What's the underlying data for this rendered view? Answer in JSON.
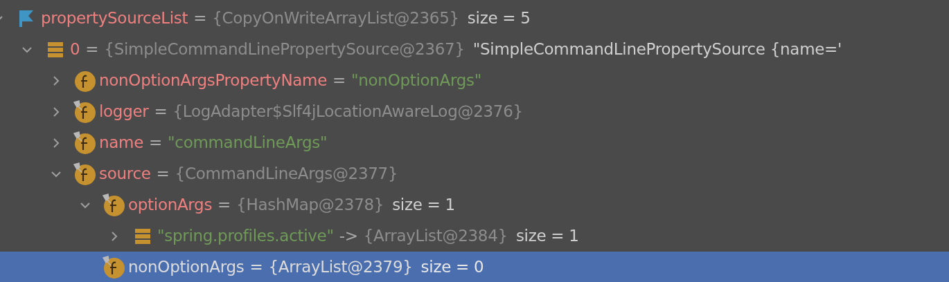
{
  "tree": [
    {
      "kind": "flag",
      "name": {
        "text": "propertySourceList",
        "kind": "field"
      },
      "separator": "=",
      "value": {
        "text": "{CopyOnWriteArrayList@2365}",
        "kind": "ref"
      },
      "extra": "size = 5",
      "expanded": true,
      "leaf": false,
      "selected": false,
      "children": [
        {
          "kind": "array",
          "name": {
            "text": "0",
            "kind": "field"
          },
          "separator": "=",
          "value": {
            "text": "{SimpleCommandLinePropertySource@2367}",
            "kind": "ref"
          },
          "extra": "\"SimpleCommandLinePropertySource {name='",
          "expanded": true,
          "leaf": false,
          "selected": false,
          "children": [
            {
              "kind": "field",
              "pinned": false,
              "name": {
                "text": "nonOptionArgsPropertyName",
                "kind": "field"
              },
              "separator": "=",
              "value": {
                "text": "\"nonOptionArgs\"",
                "kind": "string"
              },
              "expanded": false,
              "leaf": false,
              "selected": false
            },
            {
              "kind": "field",
              "pinned": true,
              "name": {
                "text": "logger",
                "kind": "field"
              },
              "separator": "=",
              "value": {
                "text": "{LogAdapter$Slf4jLocationAwareLog@2376}",
                "kind": "ref"
              },
              "expanded": false,
              "leaf": false,
              "selected": false
            },
            {
              "kind": "field",
              "pinned": true,
              "name": {
                "text": "name",
                "kind": "field"
              },
              "separator": "=",
              "value": {
                "text": "\"commandLineArgs\"",
                "kind": "string"
              },
              "expanded": false,
              "leaf": false,
              "selected": false
            },
            {
              "kind": "field",
              "pinned": true,
              "name": {
                "text": "source",
                "kind": "field"
              },
              "separator": "=",
              "value": {
                "text": "{CommandLineArgs@2377}",
                "kind": "ref"
              },
              "expanded": true,
              "leaf": false,
              "selected": false,
              "children": [
                {
                  "kind": "field",
                  "pinned": true,
                  "name": {
                    "text": "optionArgs",
                    "kind": "field"
                  },
                  "separator": "=",
                  "value": {
                    "text": "{HashMap@2378}",
                    "kind": "ref"
                  },
                  "extra": "size = 1",
                  "expanded": true,
                  "leaf": false,
                  "selected": false,
                  "children": [
                    {
                      "kind": "array",
                      "name": {
                        "text": "\"spring.profiles.active\"",
                        "kind": "string"
                      },
                      "separator": "->",
                      "value": {
                        "text": "{ArrayList@2384}",
                        "kind": "ref"
                      },
                      "extra": "size = 1",
                      "expanded": false,
                      "leaf": false,
                      "selected": false
                    }
                  ]
                },
                {
                  "kind": "field",
                  "pinned": true,
                  "name": {
                    "text": "nonOptionArgs",
                    "kind": "field"
                  },
                  "separator": "=",
                  "value": {
                    "text": "{ArrayList@2379}",
                    "kind": "ref"
                  },
                  "extra": "size = 0",
                  "leaf": true,
                  "selected": true
                }
              ]
            }
          ]
        }
      ]
    }
  ]
}
